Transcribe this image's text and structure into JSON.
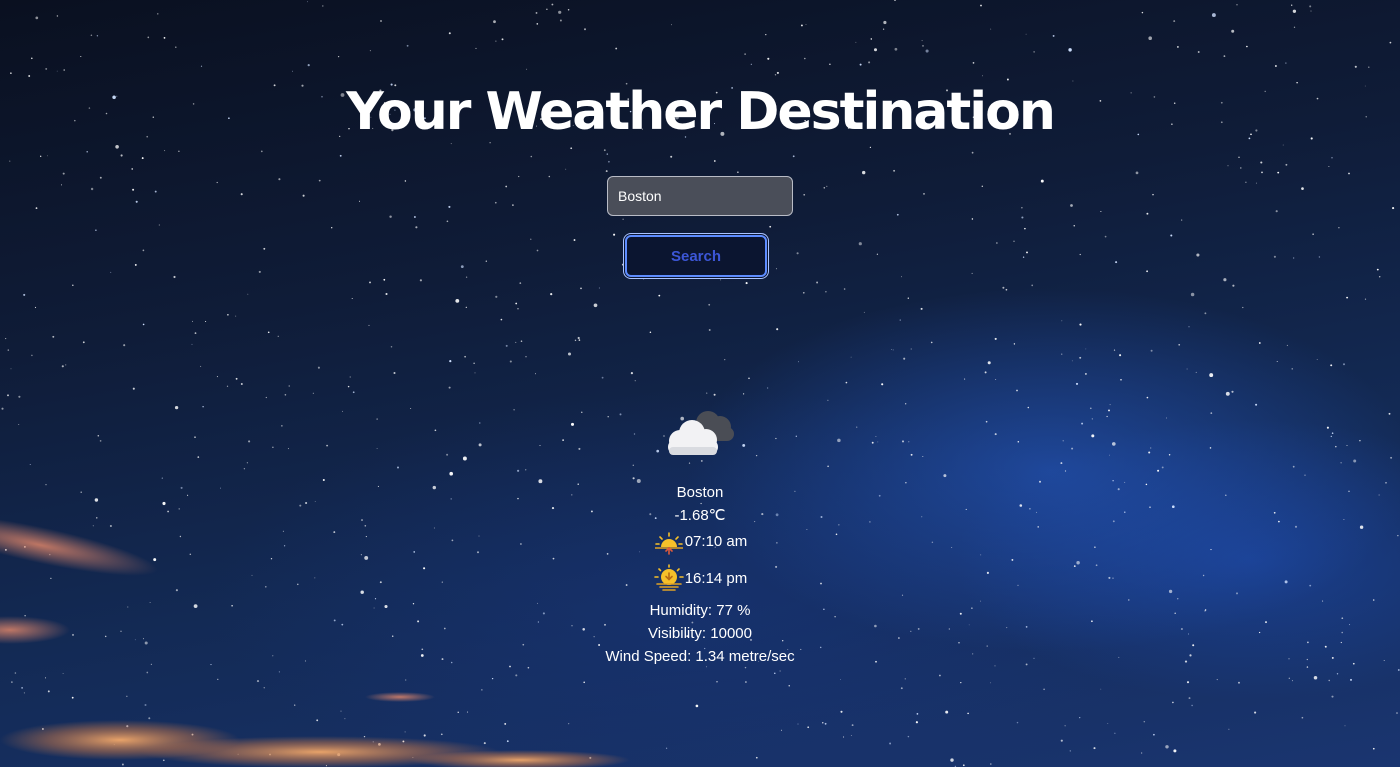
{
  "header": {
    "title": "Your Weather Destination"
  },
  "search": {
    "value": "Boston",
    "button_label": "Search"
  },
  "weather": {
    "icon": "cloud-icon",
    "city": "Boston",
    "temperature": "-1.68℃",
    "sunrise": "07:10 am",
    "sunset": "16:14 pm",
    "humidity": "Humidity: 77 %",
    "visibility": "Visibility: 10000",
    "wind_speed": "Wind Speed: 1.34 metre/sec"
  },
  "colors": {
    "button_border": "#5d8cff",
    "button_text": "#3c56d6",
    "input_background": "#4a4e59",
    "sun": "#f6c02a"
  }
}
